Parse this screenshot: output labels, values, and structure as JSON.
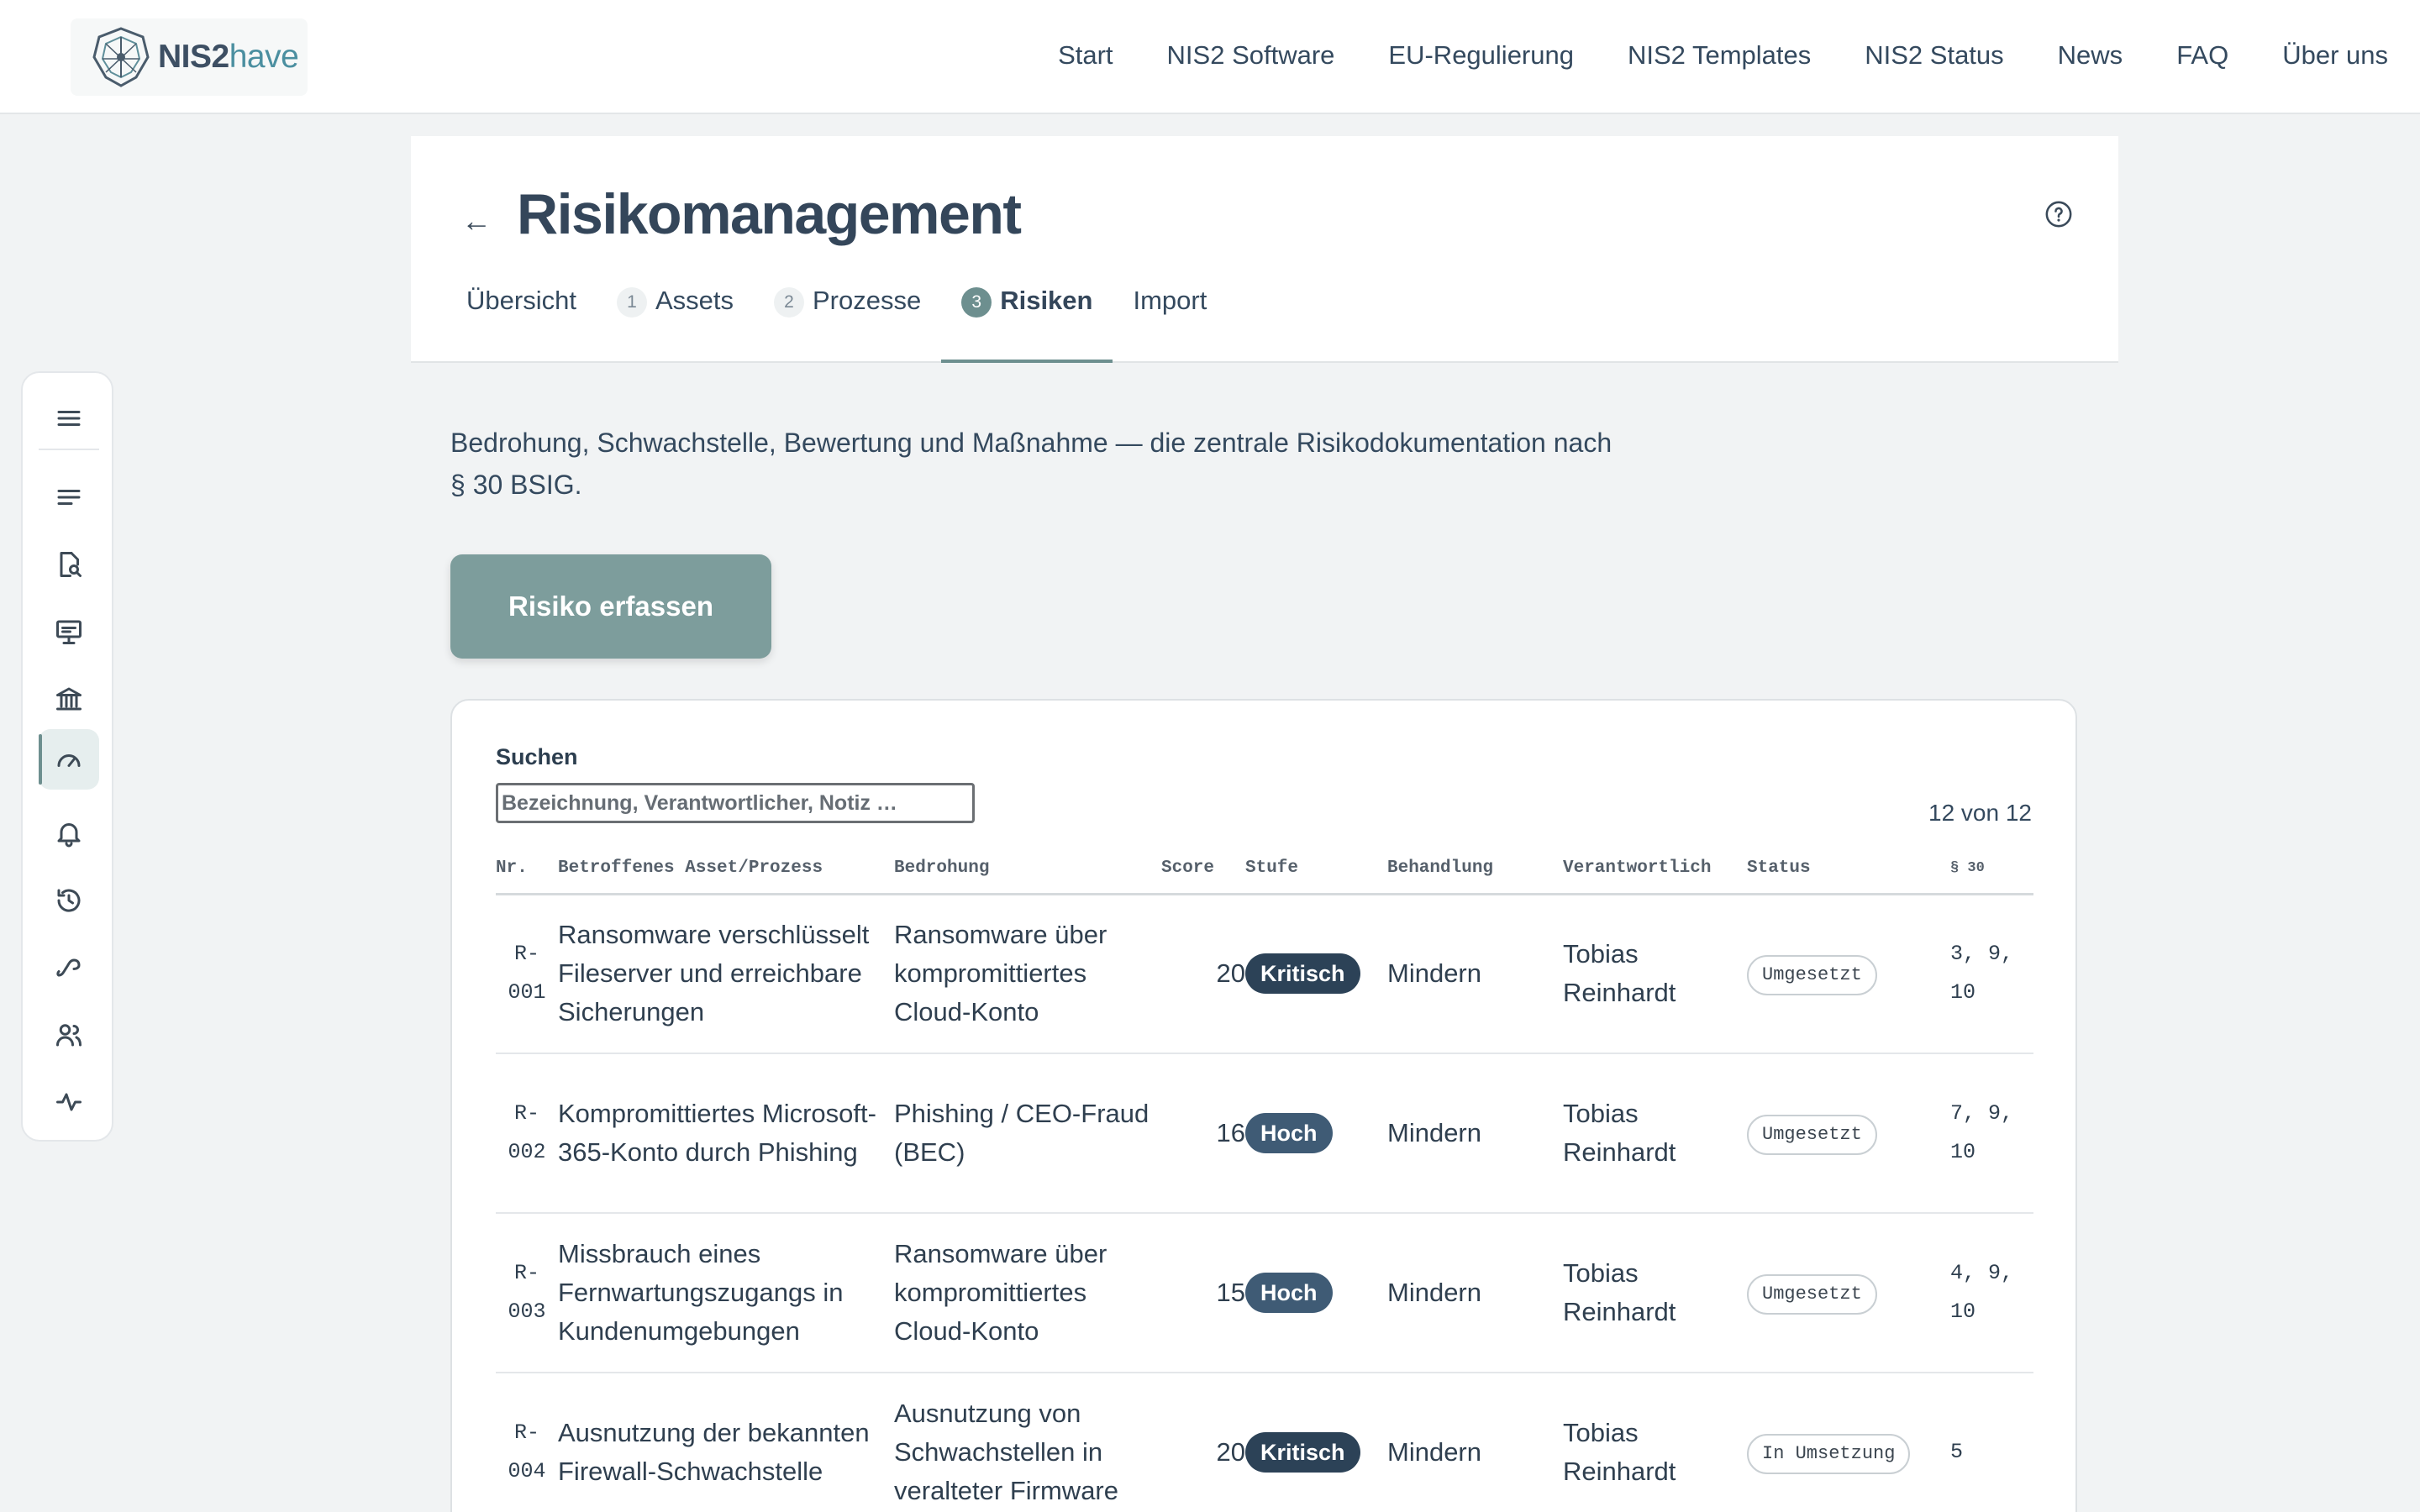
{
  "brand": {
    "name_bold": "NIS2",
    "name_light": "have"
  },
  "nav": [
    "Start",
    "NIS2 Software",
    "EU-Regulierung",
    "NIS2 Templates",
    "NIS2 Status",
    "News",
    "FAQ",
    "Über uns"
  ],
  "rail_icons": [
    "menu-icon",
    "list-icon",
    "document-search-icon",
    "presentation-icon",
    "institution-icon",
    "speedometer-icon",
    "bell-icon",
    "history-icon",
    "link-icon",
    "users-icon",
    "activity-icon"
  ],
  "page": {
    "back": "←",
    "title": "Risikomanagement",
    "tabs": [
      {
        "num": "",
        "label": "Übersicht"
      },
      {
        "num": "1",
        "label": "Assets"
      },
      {
        "num": "2",
        "label": "Prozesse"
      },
      {
        "num": "3",
        "label": "Risiken"
      },
      {
        "num": "",
        "label": "Import"
      }
    ],
    "active_tab": "Risiken",
    "intro": "Bedrohung, Schwachstelle, Bewertung und Maßnahme — die zentrale Risikodokumentation nach § 30 BSIG.",
    "cta": "Risiko erfassen"
  },
  "search": {
    "label": "Suchen",
    "placeholder": "Bezeichnung, Verantwortlicher, Notiz …",
    "count": "12 von 12"
  },
  "table": {
    "columns": [
      "Nr.",
      "Betroffenes Asset/Prozess",
      "Bedrohung",
      "Score",
      "Stufe",
      "Behandlung",
      "Verantwortlich",
      "Status",
      "§ 30"
    ],
    "rows": [
      {
        "nr": "R-001",
        "asset": "Ransomware verschlüsselt Fileserver und erreichbare Sicherungen",
        "threat": "Ransomware über kompromittiertes Cloud-Konto",
        "score": "20",
        "level": "Kritisch",
        "treatment": "Mindern",
        "owner": "Tobias Reinhardt",
        "status": "Umgesetzt",
        "ref": "3, 9, 10"
      },
      {
        "nr": "R-002",
        "asset": "Kompromittiertes Microsoft-365-Konto durch Phishing",
        "threat": "Phishing / CEO-Fraud (BEC)",
        "score": "16",
        "level": "Hoch",
        "treatment": "Mindern",
        "owner": "Tobias Reinhardt",
        "status": "Umgesetzt",
        "ref": "7, 9, 10"
      },
      {
        "nr": "R-003",
        "asset": "Missbrauch eines Fernwartungszugangs in Kundenumgebungen",
        "threat": "Ransomware über kompromittiertes Cloud-Konto",
        "score": "15",
        "level": "Hoch",
        "treatment": "Mindern",
        "owner": "Tobias Reinhardt",
        "status": "Umgesetzt",
        "ref": "4, 9, 10"
      },
      {
        "nr": "R-004",
        "asset": "Ausnutzung der bekannten Firewall-Schwachstelle",
        "threat": "Ausnutzung von Schwachstellen in veralteter Firmware",
        "score": "20",
        "level": "Kritisch",
        "treatment": "Mindern",
        "owner": "Tobias Reinhardt",
        "status": "In Umsetzung",
        "ref": "5"
      }
    ]
  },
  "colors": {
    "accent": "#6d8f8f",
    "cta_bg": "#7d9d9c",
    "level_kritisch": "#2c4257",
    "level_hoch": "#3f5b75"
  }
}
